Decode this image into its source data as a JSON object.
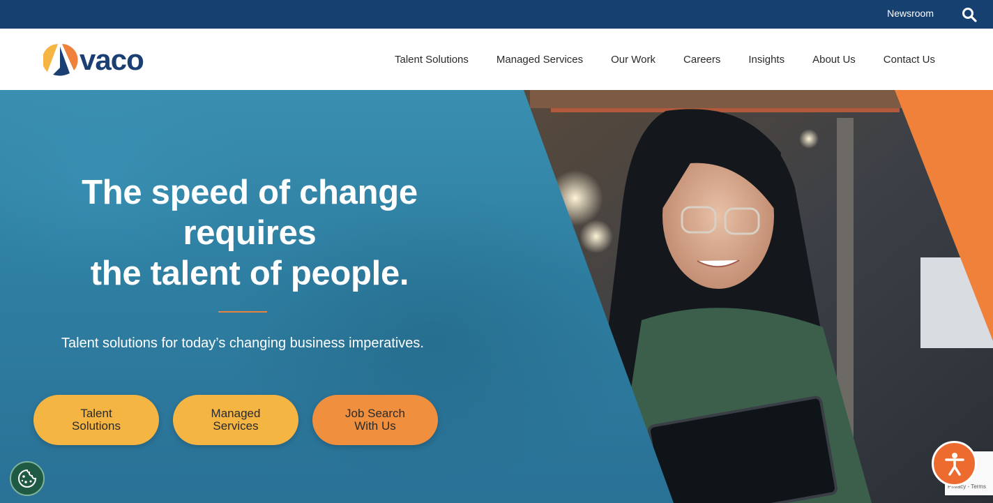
{
  "utility_bar": {
    "newsroom_label": "Newsroom",
    "search_icon": "search-icon"
  },
  "brand": {
    "logo_text": "vaco"
  },
  "nav": {
    "items": [
      {
        "label": "Talent Solutions"
      },
      {
        "label": "Managed Services"
      },
      {
        "label": "Our Work"
      },
      {
        "label": "Careers"
      },
      {
        "label": "Insights"
      },
      {
        "label": "About Us"
      },
      {
        "label": "Contact Us"
      }
    ]
  },
  "hero": {
    "headline_line1": "The speed of change",
    "headline_line2": "requires",
    "headline_line3": "the talent of people.",
    "subheadline": "Talent solutions for today’s changing business imperatives.",
    "cta_talent_line1": "Talent",
    "cta_talent_line2": "Solutions",
    "cta_managed_line1": "Managed",
    "cta_managed_line2": "Services",
    "cta_jobs_line1": "Job Search",
    "cta_jobs_line2": "With Us"
  },
  "widgets": {
    "cookie_icon": "cookie-icon",
    "accessibility_icon": "accessibility-icon",
    "recaptcha_links": "Privacy - Terms"
  },
  "colors": {
    "utility_bar": "#16406f",
    "brand_navy": "#1b3f72",
    "accent_orange": "#f0813a",
    "cta_yellow": "#f5b543",
    "cta_orange": "#f0903f",
    "hero_blue": "#2e7fa2"
  }
}
